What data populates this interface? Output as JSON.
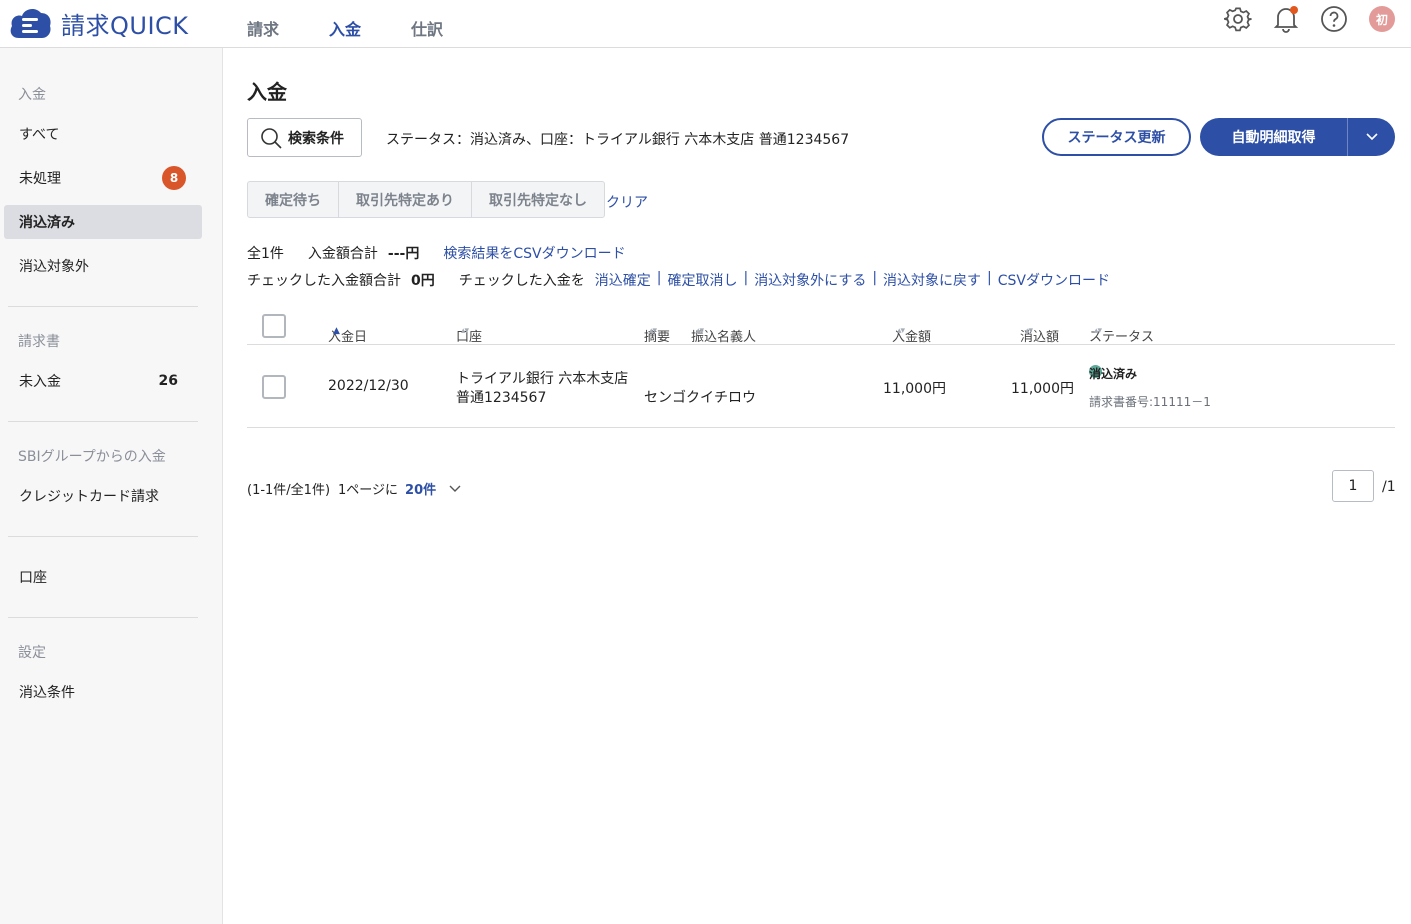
{
  "header": {
    "logo_text": "請求QUICK",
    "nav": [
      {
        "label": "請求",
        "active": false
      },
      {
        "label": "入金",
        "active": true
      },
      {
        "label": "仕訳",
        "active": false
      }
    ],
    "avatar": "初",
    "accent_color": "#2d4fa6"
  },
  "sidebar": {
    "sections": [
      {
        "heading": "入金",
        "items": [
          "すべて",
          "未処理",
          "消込済み",
          "消込対象外"
        ]
      },
      {
        "heading": "請求書",
        "items": [
          "未入金"
        ]
      },
      {
        "heading": "SBIグループからの入金",
        "items": [
          "クレジットカード請求"
        ]
      },
      {
        "items": [
          "口座"
        ]
      },
      {
        "heading": "設定",
        "items": [
          "消込条件"
        ]
      }
    ],
    "unprocessed_badge": "8",
    "unpaid_count": "26"
  },
  "main": {
    "title": "入金",
    "search_button": "検索条件",
    "condition": "ステータス：消込済み、口座：トライアル銀行 六本木支店 普通1234567",
    "status_update_button": "ステータス更新",
    "auto_fetch_button": "自動明細取得",
    "filters": [
      "確定待ち",
      "取引先特定あり",
      "取引先特定なし"
    ],
    "clear": "クリア",
    "summary": {
      "total_count": "全1件",
      "amount_label": "入金額合計",
      "amount_value": "---円",
      "csv_download": "検索結果をCSVダウンロード",
      "checked_label": "チェックした入金額合計",
      "checked_value": "0円",
      "checked_action_label": "チェックした入金を",
      "actions": [
        "消込確定",
        "確定取消し",
        "消込対象外にする",
        "消込対象に戻す",
        "CSVダウンロード"
      ]
    },
    "columns": [
      "入金日",
      "口座",
      "摘要",
      "振込名義人",
      "入金額",
      "消込額",
      "ステータス"
    ],
    "rows": [
      {
        "date": "2022/12/30",
        "account_line1": "トライアル銀行 六本木支店",
        "account_line2": "普通1234567",
        "remitter": "センゴクイチロウ",
        "amount": "11,000円",
        "cleared": "11,000円",
        "status": "消込済み",
        "invoice_no": "請求書番号:11111－1"
      }
    ],
    "pager": {
      "range": "(1-1件/全1件)",
      "per_page_label": "1ページに",
      "per_page": "20件",
      "current": "1",
      "total": "/1"
    }
  }
}
